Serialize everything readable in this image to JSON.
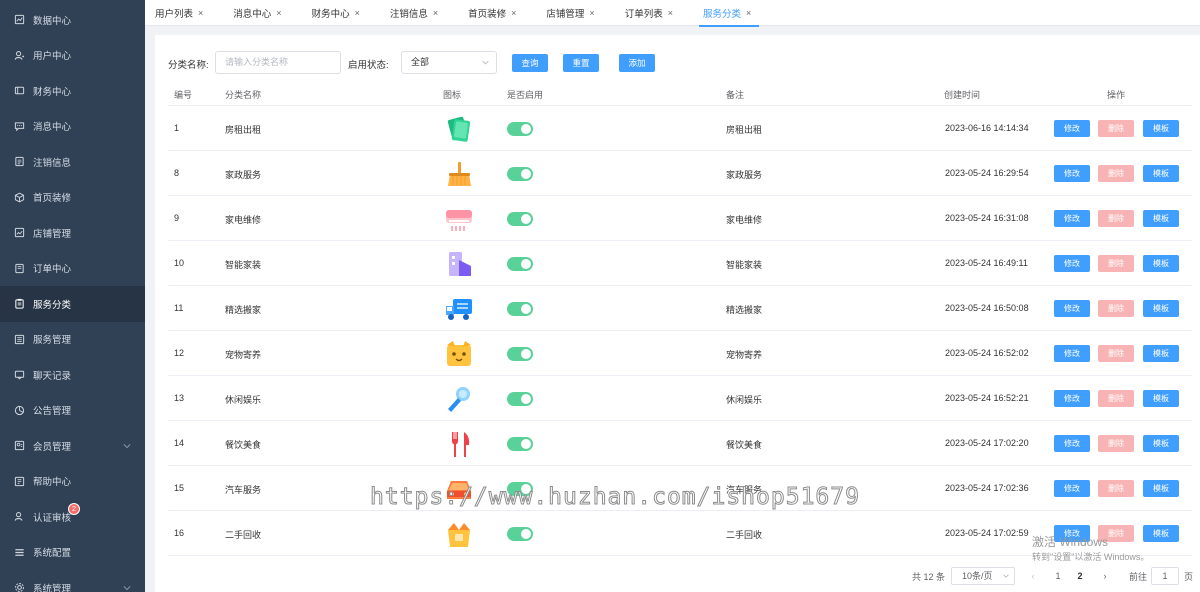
{
  "sidebar": {
    "items": [
      {
        "label": "数据中心",
        "icon": "dashboard-icon"
      },
      {
        "label": "用户中心",
        "icon": "user-icon"
      },
      {
        "label": "财务中心",
        "icon": "wallet-icon"
      },
      {
        "label": "消息中心",
        "icon": "message-icon"
      },
      {
        "label": "注销信息",
        "icon": "document-icon"
      },
      {
        "label": "首页装修",
        "icon": "cube-icon"
      },
      {
        "label": "店铺管理",
        "icon": "chart-icon"
      },
      {
        "label": "订单中心",
        "icon": "order-icon"
      },
      {
        "label": "服务分类",
        "icon": "clipboard-icon"
      },
      {
        "label": "服务管理",
        "icon": "list-icon"
      },
      {
        "label": "聊天记录",
        "icon": "chat-icon"
      },
      {
        "label": "公告管理",
        "icon": "pie-icon"
      },
      {
        "label": "会员管理",
        "icon": "member-icon"
      },
      {
        "label": "帮助中心",
        "icon": "help-icon"
      },
      {
        "label": "认证审核",
        "icon": "verify-icon",
        "badge": "2"
      },
      {
        "label": "系统配置",
        "icon": "menu-icon"
      },
      {
        "label": "系统管理",
        "icon": "settings-icon"
      }
    ]
  },
  "tabs": [
    "用户列表",
    "消息中心",
    "财务中心",
    "注销信息",
    "首页装修",
    "店铺管理",
    "订单列表",
    "服务分类"
  ],
  "tab_close": "×",
  "filters": {
    "name_label": "分类名称:",
    "name_placeholder": "请输入分类名称",
    "status_label": "启用状态:",
    "status_value": "全部",
    "query_label": "查询",
    "reset_label": "重置",
    "add_label": "添加"
  },
  "table": {
    "headers": {
      "id": "编号",
      "name": "分类名称",
      "icon": "图标",
      "enabled": "是否启用",
      "remark": "备注",
      "created": "创建时间",
      "actions": "操作"
    },
    "actions": {
      "edit": "修改",
      "delete": "删除",
      "template": "模板"
    },
    "rows": [
      {
        "id": "1",
        "name": "房租出租",
        "icon": "rent-icon",
        "enabled": true,
        "remark": "房租出租",
        "created": "2023-06-16 14:14:34"
      },
      {
        "id": "8",
        "name": "家政服务",
        "icon": "broom-icon",
        "enabled": true,
        "remark": "家政服务",
        "created": "2023-05-24 16:29:54"
      },
      {
        "id": "9",
        "name": "家电维修",
        "icon": "air-conditioner-icon",
        "enabled": true,
        "remark": "家电维修",
        "created": "2023-05-24 16:31:08"
      },
      {
        "id": "10",
        "name": "智能家装",
        "icon": "building-icon",
        "enabled": true,
        "remark": "智能家装",
        "created": "2023-05-24 16:49:11"
      },
      {
        "id": "11",
        "name": "精选搬家",
        "icon": "truck-icon",
        "enabled": true,
        "remark": "精选搬家",
        "created": "2023-05-24 16:50:08"
      },
      {
        "id": "12",
        "name": "宠物寄养",
        "icon": "pet-icon",
        "enabled": true,
        "remark": "宠物寄养",
        "created": "2023-05-24 16:52:02"
      },
      {
        "id": "13",
        "name": "休闲娱乐",
        "icon": "microphone-icon",
        "enabled": true,
        "remark": "休闲娱乐",
        "created": "2023-05-24 16:52:21"
      },
      {
        "id": "14",
        "name": "餐饮美食",
        "icon": "cutlery-icon",
        "enabled": true,
        "remark": "餐饮美食",
        "created": "2023-05-24 17:02:20"
      },
      {
        "id": "15",
        "name": "汽车服务",
        "icon": "car-icon",
        "enabled": true,
        "remark": "汽车服务",
        "created": "2023-05-24 17:02:36"
      },
      {
        "id": "16",
        "name": "二手回收",
        "icon": "recycle-box-icon",
        "enabled": true,
        "remark": "二手回收",
        "created": "2023-05-24 17:02:59"
      }
    ]
  },
  "pagination": {
    "total": "共 12 条",
    "page_size": "10条/页",
    "pages": [
      "1",
      "2"
    ],
    "current_page": "2",
    "goto_label": "前往",
    "goto_value": "1",
    "page_suffix": "页"
  },
  "watermark": "https://www.huzhan.com/ishop51679",
  "windows_activation": {
    "line1": "激活 Windows",
    "line2": "转到\"设置\"以激活 Windows。"
  }
}
